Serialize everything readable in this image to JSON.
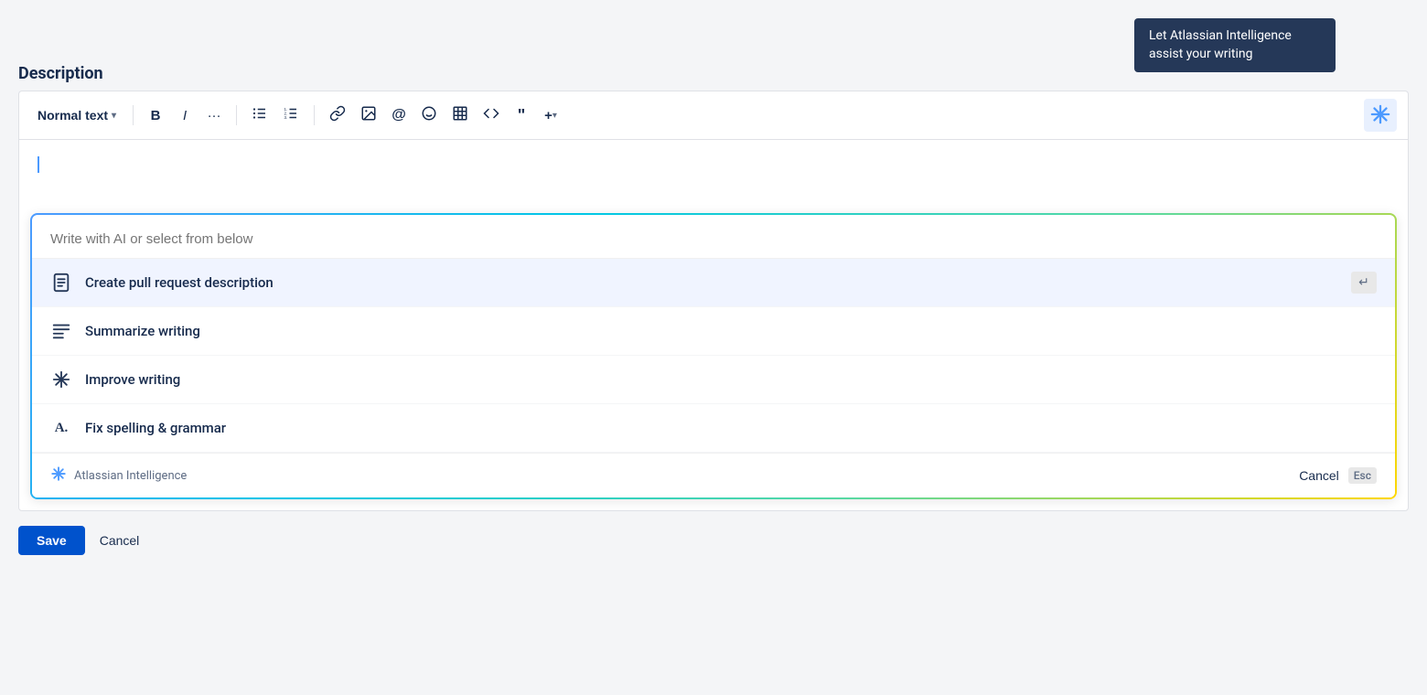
{
  "tooltip": {
    "text": "Let Atlassian Intelligence assist your writing"
  },
  "description": {
    "label": "Description"
  },
  "toolbar": {
    "text_format_label": "Normal text",
    "bold_label": "B",
    "italic_label": "I",
    "more_label": "···",
    "bullet_list_label": "≡",
    "numbered_list_label": "⁼",
    "link_label": "🔗",
    "image_label": "▪",
    "mention_label": "@",
    "emoji_label": "☺",
    "table_label": "⊞",
    "code_label": "<>",
    "quote_label": "❝",
    "more_plus_label": "+",
    "ai_label": "✳"
  },
  "ai_popup": {
    "input_placeholder": "Write with AI or select from below",
    "menu_items": [
      {
        "id": "create-pull-request",
        "label": "Create pull request description",
        "icon": "document-icon",
        "icon_char": "≡",
        "highlighted": true,
        "show_enter": true
      },
      {
        "id": "summarize-writing",
        "label": "Summarize writing",
        "icon": "summarize-icon",
        "icon_char": "≡",
        "highlighted": false,
        "show_enter": false
      },
      {
        "id": "improve-writing",
        "label": "Improve writing",
        "icon": "sparkle-icon",
        "icon_char": "✳",
        "highlighted": false,
        "show_enter": false
      },
      {
        "id": "fix-spelling",
        "label": "Fix spelling & grammar",
        "icon": "spell-icon",
        "icon_char": "A.",
        "highlighted": false,
        "show_enter": false
      }
    ],
    "footer": {
      "branding_label": "Atlassian Intelligence",
      "cancel_label": "Cancel",
      "esc_label": "Esc"
    }
  },
  "bottom_actions": {
    "save_label": "Save",
    "cancel_label": "Cancel"
  }
}
